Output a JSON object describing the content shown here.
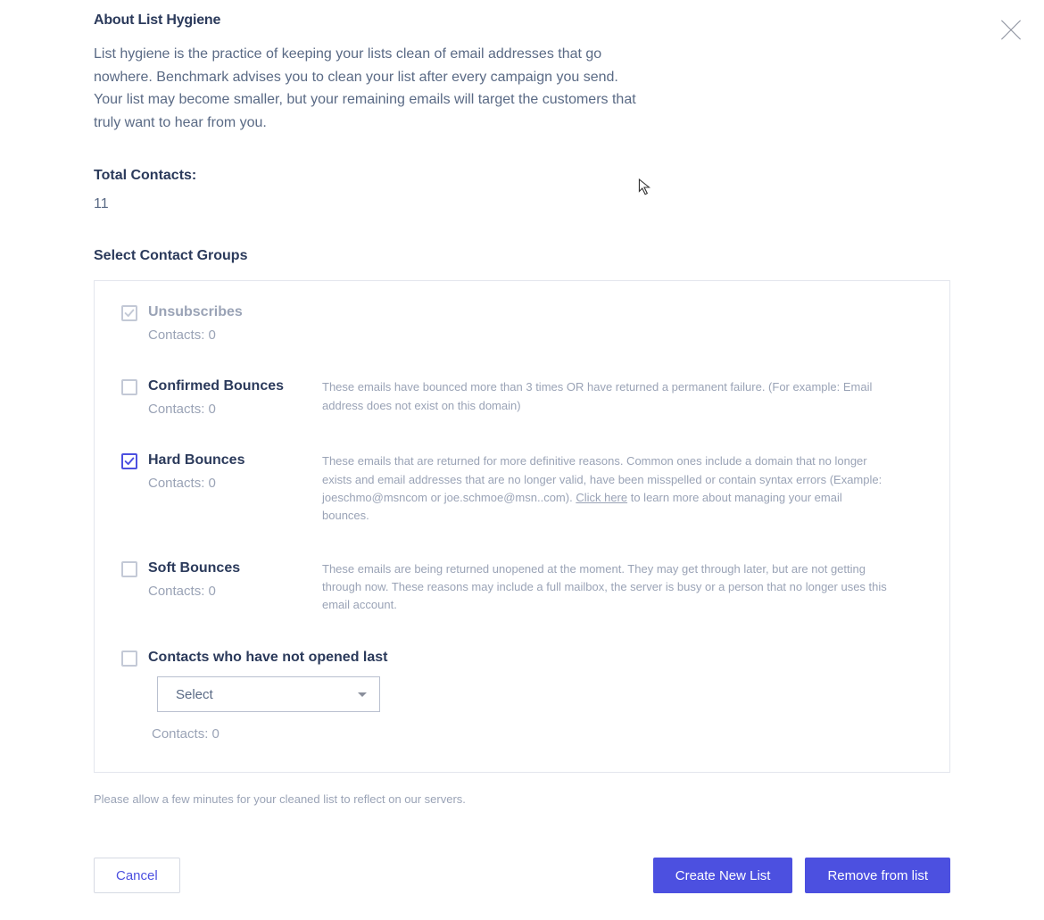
{
  "header": {
    "title": "About List Hygiene",
    "description": "List hygiene is the practice of keeping your lists clean of email addresses that go nowhere. Benchmark advises you to clean your list after every campaign you send. Your list may become smaller, but your remaining emails will target the customers that truly want to hear from you."
  },
  "total": {
    "label": "Total Contacts:",
    "value": "11"
  },
  "groups_title": "Select Contact Groups",
  "groups": {
    "unsubscribes": {
      "label": "Unsubscribes",
      "contacts": "Contacts: 0"
    },
    "confirmed": {
      "label": "Confirmed Bounces",
      "contacts": "Contacts: 0",
      "desc": "These emails have bounced more than 3 times OR have returned a permanent failure. (For example: Email address does not exist on this domain)"
    },
    "hard": {
      "label": "Hard Bounces",
      "contacts": "Contacts: 0",
      "desc1": "These emails that are returned for more definitive reasons. Common ones include a domain that no longer exists and email addresses that are no longer valid, have been misspelled or contain syntax errors (Example: joeschmo@msncom or joe.schmoe@msn..com). ",
      "link": "Click here",
      "desc2": " to learn more about managing your email bounces."
    },
    "soft": {
      "label": "Soft Bounces",
      "contacts": "Contacts: 0",
      "desc": "These emails are being returned unopened at the moment. They may get through later, but are not getting through now. These reasons may include a full mailbox, the server is busy or a person that no longer uses this email account."
    },
    "notopen": {
      "label": "Contacts who have not opened last",
      "contacts": "Contacts: 0",
      "select": "Select"
    }
  },
  "footer_note": "Please allow a few minutes for your cleaned list to reflect on our servers.",
  "actions": {
    "cancel": "Cancel",
    "create": "Create New List",
    "remove": "Remove from list"
  }
}
